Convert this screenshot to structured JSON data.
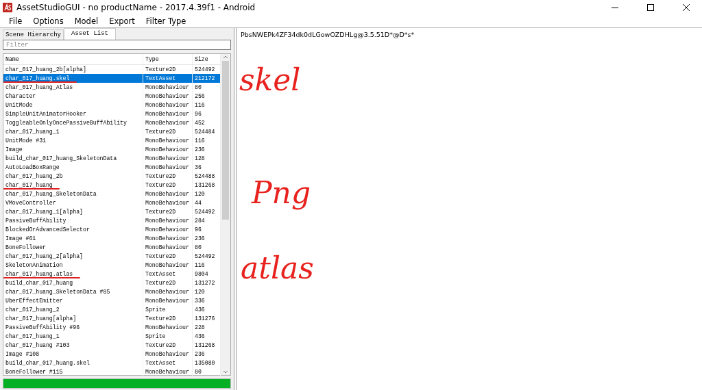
{
  "window": {
    "title": "AssetStudioGUI - no productName - 2017.4.39f1 - Android"
  },
  "menu": [
    "File",
    "Options",
    "Model",
    "Export",
    "Filter Type"
  ],
  "tabs": [
    {
      "label": "Scene Hierarchy",
      "selected": false
    },
    {
      "label": "Asset List",
      "selected": true
    }
  ],
  "filter": {
    "placeholder": "Filter"
  },
  "table": {
    "columns": [
      "Name",
      "Type",
      "Size"
    ],
    "rows": [
      {
        "name": "char_017_huang_2b[alpha]",
        "type": "Texture2D",
        "size": "524492",
        "selected": false,
        "underlined": false
      },
      {
        "name": "char_017_huang.skel",
        "type": "TextAsset",
        "size": "212172",
        "selected": true,
        "underlined": true
      },
      {
        "name": "char_017_huang_Atlas",
        "type": "MonoBehaviour",
        "size": "80",
        "selected": false,
        "underlined": false
      },
      {
        "name": "Character",
        "type": "MonoBehaviour",
        "size": "256",
        "selected": false,
        "underlined": false
      },
      {
        "name": "UnitMode",
        "type": "MonoBehaviour",
        "size": "116",
        "selected": false,
        "underlined": false
      },
      {
        "name": "SimpleUnitAnimatorHooker",
        "type": "MonoBehaviour",
        "size": "96",
        "selected": false,
        "underlined": false
      },
      {
        "name": "ToggleableOnlyOncePassiveBuffAbility",
        "type": "MonoBehaviour",
        "size": "452",
        "selected": false,
        "underlined": false
      },
      {
        "name": "char_017_huang_1",
        "type": "Texture2D",
        "size": "524484",
        "selected": false,
        "underlined": false
      },
      {
        "name": "UnitMode #31",
        "type": "MonoBehaviour",
        "size": "116",
        "selected": false,
        "underlined": false
      },
      {
        "name": "Image",
        "type": "MonoBehaviour",
        "size": "236",
        "selected": false,
        "underlined": false
      },
      {
        "name": "build_char_017_huang_SkeletonData",
        "type": "MonoBehaviour",
        "size": "128",
        "selected": false,
        "underlined": false
      },
      {
        "name": "AutoLoadBoxRange",
        "type": "MonoBehaviour",
        "size": "36",
        "selected": false,
        "underlined": false
      },
      {
        "name": "char_017_huang_2b",
        "type": "Texture2D",
        "size": "524488",
        "selected": false,
        "underlined": false
      },
      {
        "name": "char_017_huang",
        "type": "Texture2D",
        "size": "131268",
        "selected": false,
        "underlined": true
      },
      {
        "name": "char_017_huang_SkeletonData",
        "type": "MonoBehaviour",
        "size": "120",
        "selected": false,
        "underlined": false
      },
      {
        "name": "VMoveController",
        "type": "MonoBehaviour",
        "size": "44",
        "selected": false,
        "underlined": false
      },
      {
        "name": "char_017_huang_1[alpha]",
        "type": "Texture2D",
        "size": "524492",
        "selected": false,
        "underlined": false
      },
      {
        "name": "PassiveBuffAbility",
        "type": "MonoBehaviour",
        "size": "284",
        "selected": false,
        "underlined": false
      },
      {
        "name": "BlockedOrAdvancedSelector",
        "type": "MonoBehaviour",
        "size": "96",
        "selected": false,
        "underlined": false
      },
      {
        "name": "Image #61",
        "type": "MonoBehaviour",
        "size": "236",
        "selected": false,
        "underlined": false
      },
      {
        "name": "BoneFollower",
        "type": "MonoBehaviour",
        "size": "80",
        "selected": false,
        "underlined": false
      },
      {
        "name": "char_017_huang_2[alpha]",
        "type": "Texture2D",
        "size": "524492",
        "selected": false,
        "underlined": false
      },
      {
        "name": "SkeletonAnimation",
        "type": "MonoBehaviour",
        "size": "116",
        "selected": false,
        "underlined": false
      },
      {
        "name": "char_017_huang.atlas",
        "type": "TextAsset",
        "size": "9804",
        "selected": false,
        "underlined": true
      },
      {
        "name": "build_char_017_huang",
        "type": "Texture2D",
        "size": "131272",
        "selected": false,
        "underlined": false
      },
      {
        "name": "char_017_huang_SkeletonData #85",
        "type": "MonoBehaviour",
        "size": "120",
        "selected": false,
        "underlined": false
      },
      {
        "name": "UberEffectEmitter",
        "type": "MonoBehaviour",
        "size": "336",
        "selected": false,
        "underlined": false
      },
      {
        "name": "char_017_huang_2",
        "type": "Sprite",
        "size": "436",
        "selected": false,
        "underlined": false
      },
      {
        "name": "char_017_huang[alpha]",
        "type": "Texture2D",
        "size": "131276",
        "selected": false,
        "underlined": false
      },
      {
        "name": "PassiveBuffAbility #96",
        "type": "MonoBehaviour",
        "size": "228",
        "selected": false,
        "underlined": false
      },
      {
        "name": "char_017_huang_1",
        "type": "Sprite",
        "size": "436",
        "selected": false,
        "underlined": false
      },
      {
        "name": "char_017_huang #103",
        "type": "Texture2D",
        "size": "131268",
        "selected": false,
        "underlined": false
      },
      {
        "name": "Image #108",
        "type": "MonoBehaviour",
        "size": "236",
        "selected": false,
        "underlined": false
      },
      {
        "name": "build_char_017_huang.skel",
        "type": "TextAsset",
        "size": "135080",
        "selected": false,
        "underlined": false
      },
      {
        "name": "BoneFollower #115",
        "type": "MonoBehaviour",
        "size": "80",
        "selected": false,
        "underlined": false
      }
    ]
  },
  "progress": {
    "level": 1
  },
  "preview": {
    "text": "PbsNWEPk4ZF34dk0dLGowOZDHLg@3.5.51D*@D*s*"
  },
  "annotations": [
    {
      "text": "skel"
    },
    {
      "text": "Png"
    },
    {
      "text": "atlas"
    }
  ]
}
